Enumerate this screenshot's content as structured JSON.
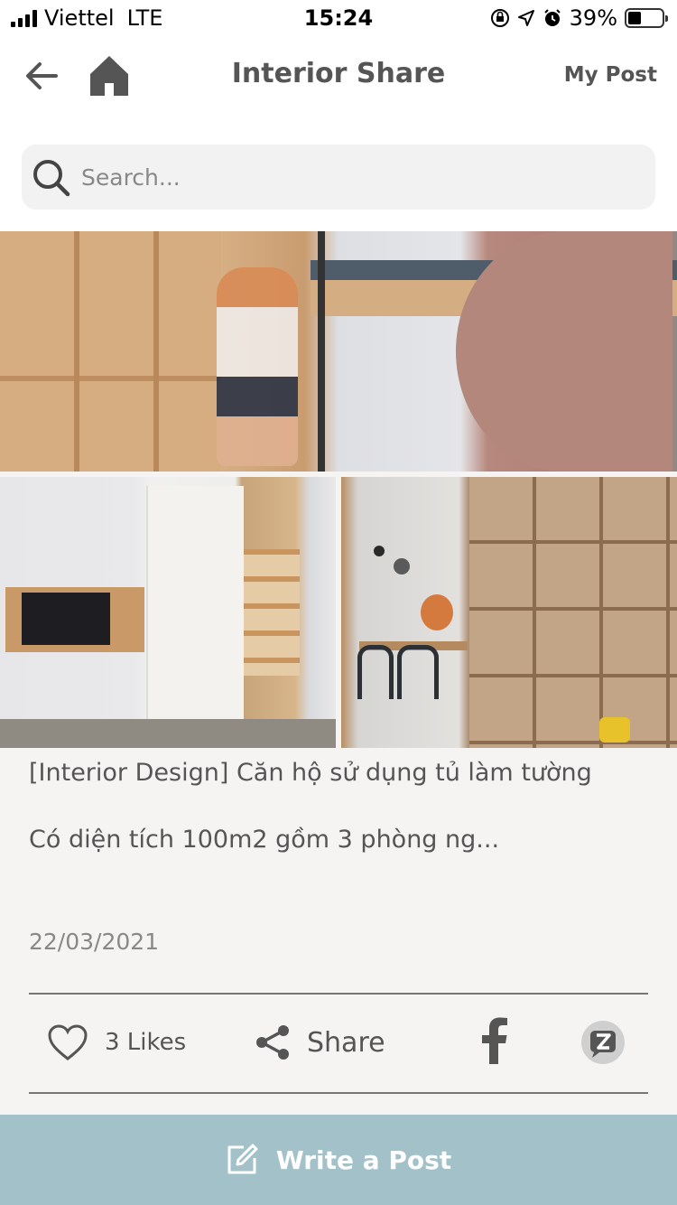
{
  "status_bar": {
    "carrier": "Viettel",
    "network": "LTE",
    "time": "15:24",
    "battery": "39%",
    "battery_level": 0.39
  },
  "header": {
    "title": "Interior Share",
    "my_post_label": "My Post",
    "icons": {
      "back": "arrow-left-icon",
      "home": "home-icon"
    }
  },
  "search": {
    "placeholder": "Search...",
    "value": ""
  },
  "post": {
    "title": "[Interior Design] Căn hộ sử dụng tủ làm tường",
    "excerpt": "Có diện tích 100m2 gồm 3 phòng ng...",
    "date": "22/03/2021",
    "likes_label": "3 Likes",
    "share_label": "Share",
    "icons": {
      "like": "heart-icon",
      "share": "share-icon",
      "facebook": "facebook-icon",
      "zalo": "zalo-icon"
    }
  },
  "bottom_bar": {
    "write_label": "Write a Post",
    "icon": "edit-icon",
    "color": "#a3c1c8"
  }
}
